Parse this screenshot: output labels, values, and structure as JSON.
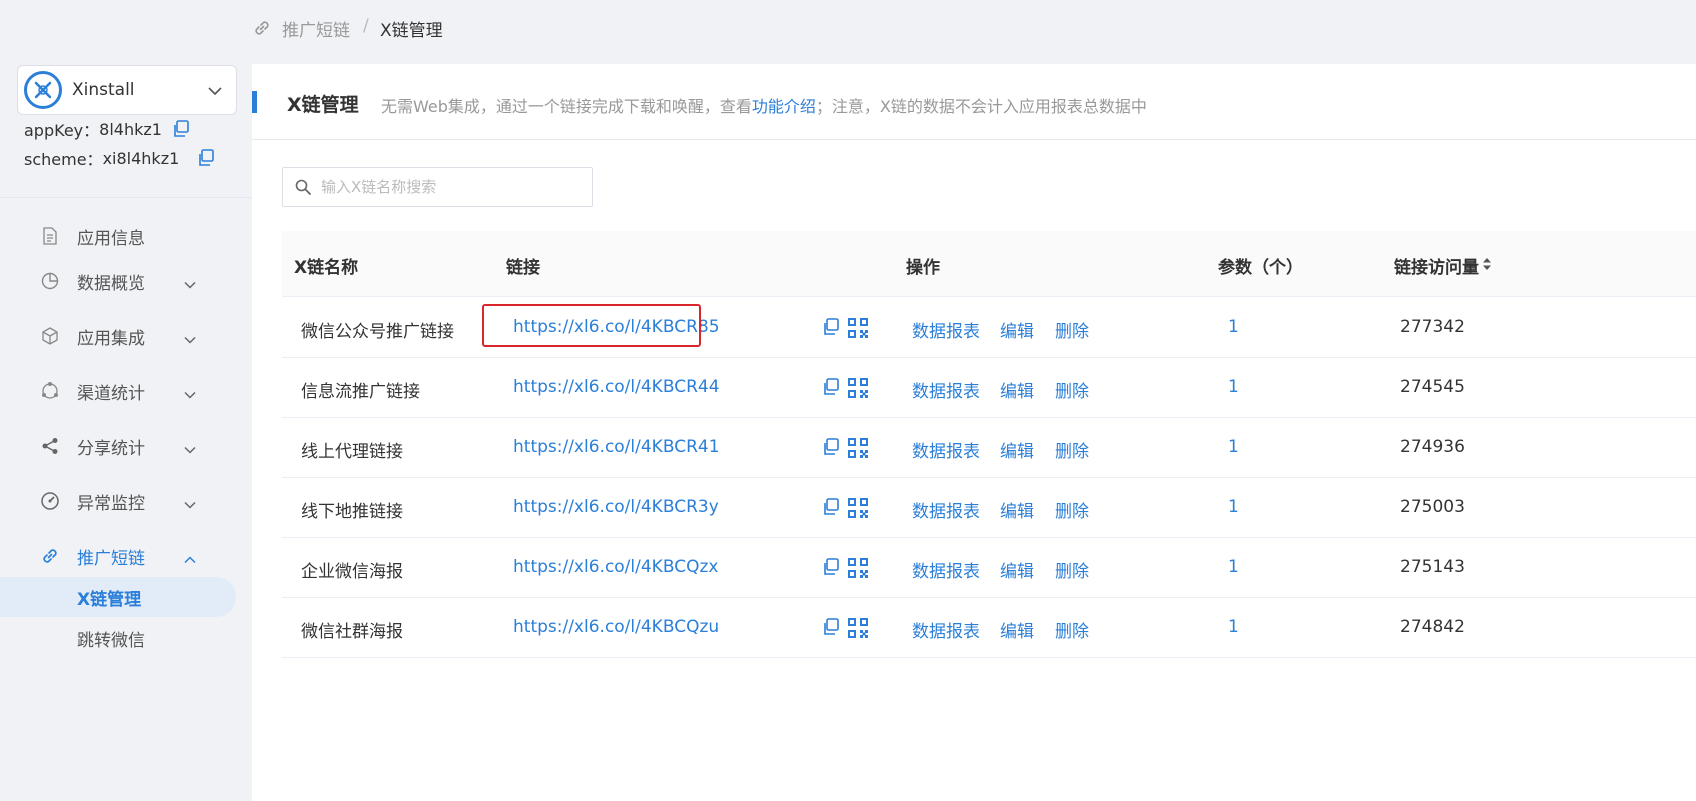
{
  "breadcrumb": {
    "parent": "推广短链",
    "separator": "/",
    "current": "X链管理"
  },
  "app": {
    "name": "Xinstall",
    "appkey_label": "appKey：",
    "appkey": "8l4hkz1",
    "scheme_label": "scheme：",
    "scheme": "xi8l4hkz1"
  },
  "sidebar": {
    "items": [
      {
        "label": "应用信息",
        "icon": "document-icon"
      },
      {
        "label": "数据概览",
        "icon": "pie-chart-icon"
      },
      {
        "label": "应用集成",
        "icon": "cube-icon"
      },
      {
        "label": "渠道统计",
        "icon": "channel-icon"
      },
      {
        "label": "分享统计",
        "icon": "share-icon"
      },
      {
        "label": "异常监控",
        "icon": "gauge-icon"
      },
      {
        "label": "推广短链",
        "icon": "link-icon"
      }
    ],
    "subitems": [
      {
        "label": "X链管理"
      },
      {
        "label": "跳转微信"
      }
    ]
  },
  "page": {
    "title": "X链管理",
    "desc_before": "无需Web集成，通过一个链接完成下载和唤醒，查看",
    "desc_link": "功能介绍",
    "desc_after": "；注意，X链的数据不会计入应用报表总数据中"
  },
  "search": {
    "placeholder": "输入X链名称搜索"
  },
  "table": {
    "headers": {
      "name": "X链名称",
      "link": "链接",
      "ops": "操作",
      "params": "参数（个）",
      "visits": "链接访问量"
    },
    "actions": {
      "report": "数据报表",
      "edit": "编辑",
      "delete": "删除"
    },
    "rows": [
      {
        "name": "微信公众号推广链接",
        "url": "https://xl6.co/l/4KBCR85",
        "params": "1",
        "visits": "277342"
      },
      {
        "name": "信息流推广链接",
        "url": "https://xl6.co/l/4KBCR44",
        "params": "1",
        "visits": "274545"
      },
      {
        "name": "线上代理链接",
        "url": "https://xl6.co/l/4KBCR41",
        "params": "1",
        "visits": "274936"
      },
      {
        "name": "线下地推链接",
        "url": "https://xl6.co/l/4KBCR3y",
        "params": "1",
        "visits": "275003"
      },
      {
        "name": "企业微信海报",
        "url": "https://xl6.co/l/4KBCQzx",
        "params": "1",
        "visits": "275143"
      },
      {
        "name": "微信社群海报",
        "url": "https://xl6.co/l/4KBCQzu",
        "params": "1",
        "visits": "274842"
      }
    ]
  },
  "colors": {
    "accent": "#2b7fd8",
    "highlight": "#d9262c"
  }
}
